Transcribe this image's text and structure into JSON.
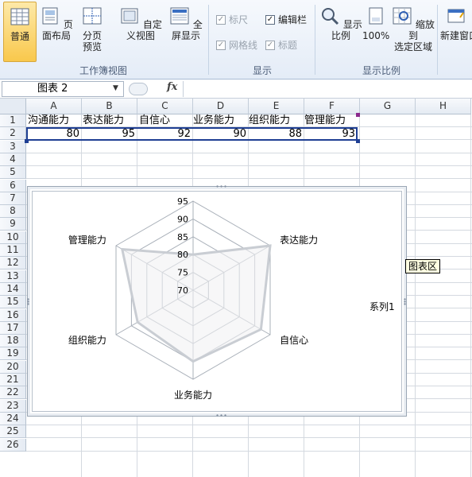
{
  "ribbon": {
    "workbook_views": {
      "buttons": [
        {
          "label": "普通",
          "active": true
        },
        {
          "label": "页面布局",
          "active": false
        },
        {
          "label": "分页\n预览",
          "active": false
        },
        {
          "label": "自定义视图",
          "active": false
        },
        {
          "label": "全屏显示",
          "active": false
        }
      ],
      "group_label": "工作簿视图"
    },
    "show": {
      "checkboxes": [
        {
          "label": "标尺",
          "checked": true,
          "enabled": false
        },
        {
          "label": "编辑栏",
          "checked": true,
          "enabled": true
        },
        {
          "label": "网格线",
          "checked": true,
          "enabled": false
        },
        {
          "label": "标题",
          "checked": true,
          "enabled": false
        }
      ],
      "group_label": "显示"
    },
    "zoom": {
      "buttons": [
        {
          "label": "显示比例"
        },
        {
          "label": "100%"
        },
        {
          "label": "缩放到\n选定区域"
        }
      ],
      "group_label": "显示比例"
    },
    "window": {
      "new_window_label": "新建窗口"
    }
  },
  "formula_bar": {
    "name_box": "图表 2",
    "fx": "fx"
  },
  "sheet": {
    "columns": [
      "A",
      "B",
      "C",
      "D",
      "E",
      "F",
      "G",
      "H"
    ],
    "rows": [
      "1",
      "2",
      "3",
      "4",
      "5",
      "6",
      "7",
      "8",
      "9",
      "10",
      "11",
      "12",
      "13",
      "14",
      "15",
      "16",
      "17",
      "18",
      "19",
      "20",
      "21",
      "22",
      "23",
      "24",
      "25",
      "26"
    ],
    "headers": [
      "沟通能力",
      "表达能力",
      "自信心",
      "业务能力",
      "组织能力",
      "管理能力"
    ],
    "values": [
      "80",
      "95",
      "92",
      "90",
      "88",
      "93"
    ]
  },
  "chart_data": {
    "type": "radar",
    "categories": [
      "沟通能力",
      "表达能力",
      "自信心",
      "业务能力",
      "组织能力",
      "管理能力"
    ],
    "series": [
      {
        "name": "系列1",
        "values": [
          80,
          95,
          92,
          90,
          88,
          93
        ]
      }
    ],
    "axis": {
      "min": 70,
      "max": 95,
      "ticks": [
        "70",
        "75",
        "80",
        "85",
        "90",
        "95"
      ]
    },
    "legend": "right",
    "tooltip": "图表区"
  }
}
